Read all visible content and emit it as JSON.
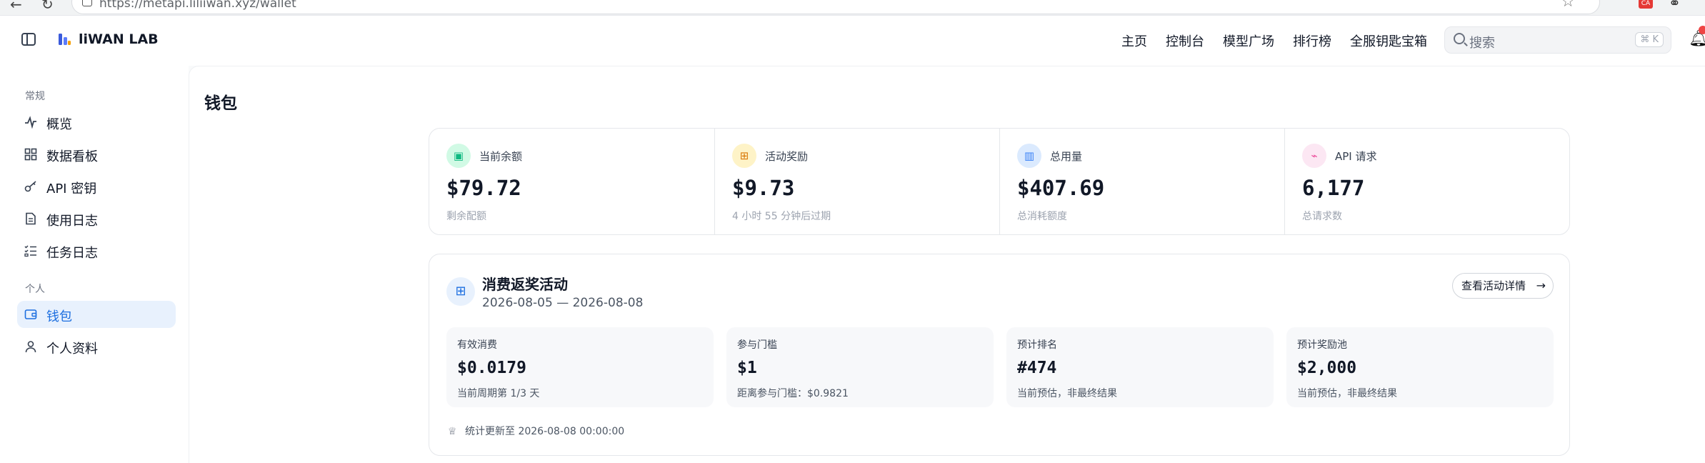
{
  "browser": {
    "url": "https://metapi.liliiwan.xyz/wallet",
    "ext_badge": "CA"
  },
  "header": {
    "brand": "liWAN LAB",
    "nav": [
      "主页",
      "控制台",
      "模型广场",
      "排行榜",
      "全服钥匙宝箱"
    ],
    "search_placeholder": "搜索",
    "search_shortcut": "⌘ K"
  },
  "sidebar": {
    "section_general": "常规",
    "section_personal": "个人",
    "items_general": [
      {
        "label": "概览",
        "icon": "activity-icon"
      },
      {
        "label": "数据看板",
        "icon": "dashboard-icon"
      },
      {
        "label": "API 密钥",
        "icon": "key-icon"
      },
      {
        "label": "使用日志",
        "icon": "document-icon"
      },
      {
        "label": "任务日志",
        "icon": "task-list-icon"
      }
    ],
    "items_personal": [
      {
        "label": "钱包",
        "icon": "wallet-icon",
        "active": true
      },
      {
        "label": "个人资料",
        "icon": "user-icon"
      }
    ]
  },
  "page": {
    "title": "钱包"
  },
  "stats": [
    {
      "label": "当前余额",
      "value": "$79.72",
      "sub": "剩余配额",
      "icon": "wallet-icon",
      "color": "#10b981"
    },
    {
      "label": "活动奖励",
      "value": "$9.73",
      "sub": "4 小时 55 分钟后过期",
      "icon": "gift-icon",
      "color": "#f59e0b"
    },
    {
      "label": "总用量",
      "value": "$407.69",
      "sub": "总消耗额度",
      "icon": "bar-chart-icon",
      "color": "#3b82f6"
    },
    {
      "label": "API 请求",
      "value": "6,177",
      "sub": "总请求数",
      "icon": "pulse-icon",
      "color": "#ec4899"
    }
  ],
  "activity": {
    "title": "消费返奖活动",
    "date_range": "2026-08-05 — 2026-08-08",
    "details_button": "查看活动详情",
    "metrics": [
      {
        "label": "有效消费",
        "value": "$0.0179",
        "sub": "当前周期第 1/3 天"
      },
      {
        "label": "参与门槛",
        "value": "$1",
        "sub": "距离参与门槛：$0.9821"
      },
      {
        "label": "预计排名",
        "value": "#474",
        "sub": "当前预估，非最终结果"
      },
      {
        "label": "预计奖励池",
        "value": "$2,000",
        "sub": "当前预估，非最终结果"
      }
    ],
    "footer": "统计更新至 2026-08-08 00:00:00"
  },
  "colors": {
    "accent": "#1d6fe0",
    "active_bg": "#e8f1fd"
  }
}
